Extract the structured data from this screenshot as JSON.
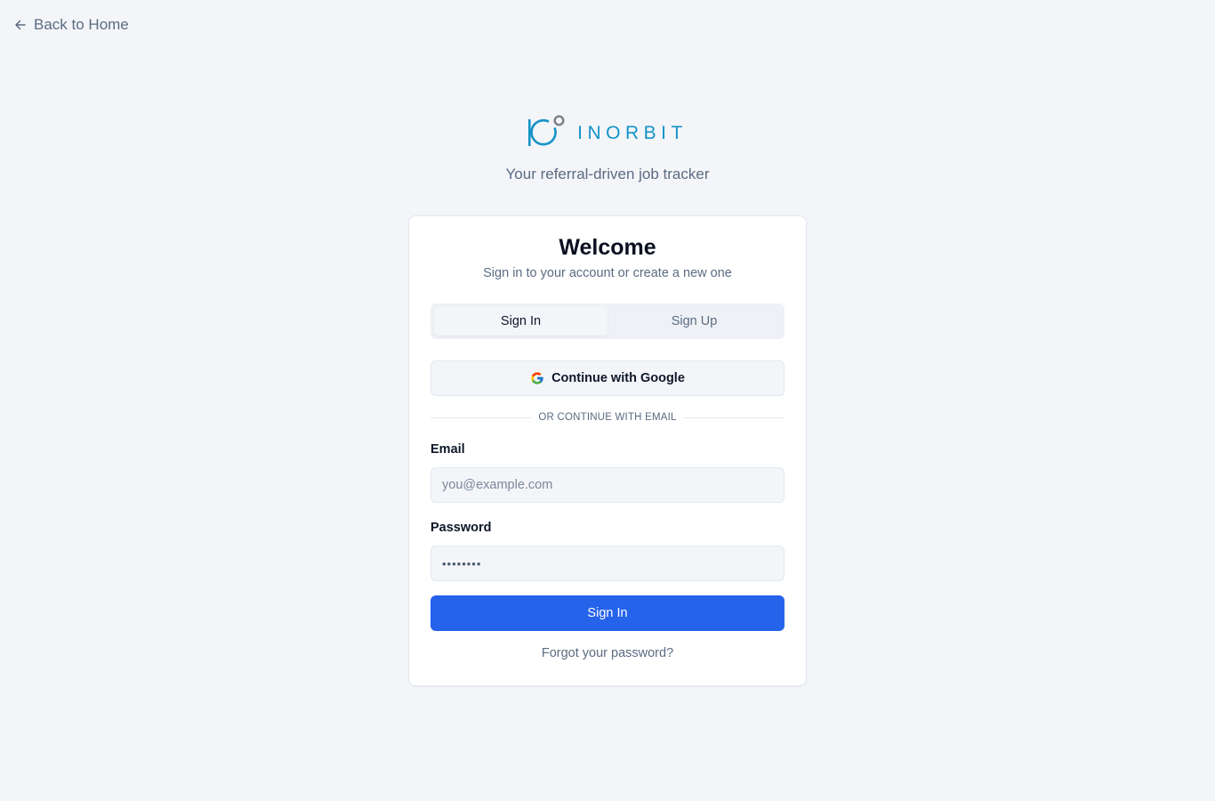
{
  "nav": {
    "back_label": "Back to Home",
    "back_icon": "arrow-left-icon"
  },
  "brand": {
    "logo_text": "INORBIT",
    "logo_icon": "inorbit-logo-mark",
    "tagline": "Your referral-driven job tracker",
    "brand_color": "#1593c7",
    "orbit_color": "#7b7f86"
  },
  "card": {
    "title": "Welcome",
    "subtitle": "Sign in to your account or create a new one"
  },
  "tabs": [
    {
      "label": "Sign In",
      "active": true
    },
    {
      "label": "Sign Up",
      "active": false
    }
  ],
  "google": {
    "label": "Continue with Google",
    "icon": "google-icon"
  },
  "divider_text": "OR CONTINUE WITH EMAIL",
  "email": {
    "label": "Email",
    "placeholder": "you@example.com",
    "value": ""
  },
  "password": {
    "label": "Password",
    "placeholder": "••••••••",
    "value": ""
  },
  "submit_label": "Sign In",
  "forgot_label": "Forgot your password?",
  "colors": {
    "background": "#f3f5f8",
    "primary_button": "#2563eb",
    "muted_text": "#5b6b82"
  }
}
